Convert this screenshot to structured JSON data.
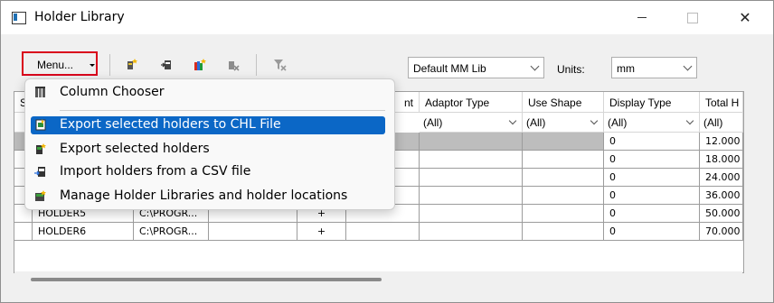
{
  "window": {
    "title": "Holder Library",
    "close_glyph": "✕"
  },
  "toolbar": {
    "menu_label": "Menu...",
    "icons": [
      "add-holder-icon",
      "import-holder-icon",
      "colors-icon",
      "delete-holder-icon",
      "clear-filter-icon"
    ],
    "library_select": "Default MM Lib",
    "units_label": "Units:",
    "units_select": "mm"
  },
  "menu": {
    "items": [
      {
        "label": "Column Chooser",
        "icon": "column-chooser-icon"
      },
      {
        "label": "Export selected holders to CHL File",
        "icon": "export-chl-icon",
        "highlighted": true
      },
      {
        "label": "Export selected holders",
        "icon": "export-holders-icon"
      },
      {
        "label": "Import holders from a CSV file",
        "icon": "import-csv-icon"
      },
      {
        "label": "Manage Holder Libraries and holder locations",
        "icon": "manage-libraries-icon"
      }
    ]
  },
  "grid": {
    "columns": [
      "S",
      "",
      "",
      "",
      "nt",
      "Adaptor Type",
      "Use Shape",
      "Display Type",
      "Total H"
    ],
    "filter_value": "(All)",
    "rows": [
      {
        "name": "",
        "path": "",
        "flag": "",
        "display": "0",
        "total": "12.000",
        "selected": true
      },
      {
        "name": "",
        "path": "",
        "flag": "",
        "display": "0",
        "total": "18.000"
      },
      {
        "name": "",
        "path": "",
        "flag": "",
        "display": "0",
        "total": "24.000"
      },
      {
        "name": "",
        "path": "",
        "flag": "",
        "display": "0",
        "total": "36.000"
      },
      {
        "name": "HOLDER5",
        "path": "C:\\PROGR...",
        "flag": "+",
        "display": "0",
        "total": "50.000"
      },
      {
        "name": "HOLDER6",
        "path": "C:\\PROGR...",
        "flag": "+",
        "display": "0",
        "total": "70.000"
      }
    ]
  },
  "colors": {
    "accent": "#0b67c6",
    "highlight_border": "#d9001b",
    "selected_row": "#bdbdbd"
  }
}
